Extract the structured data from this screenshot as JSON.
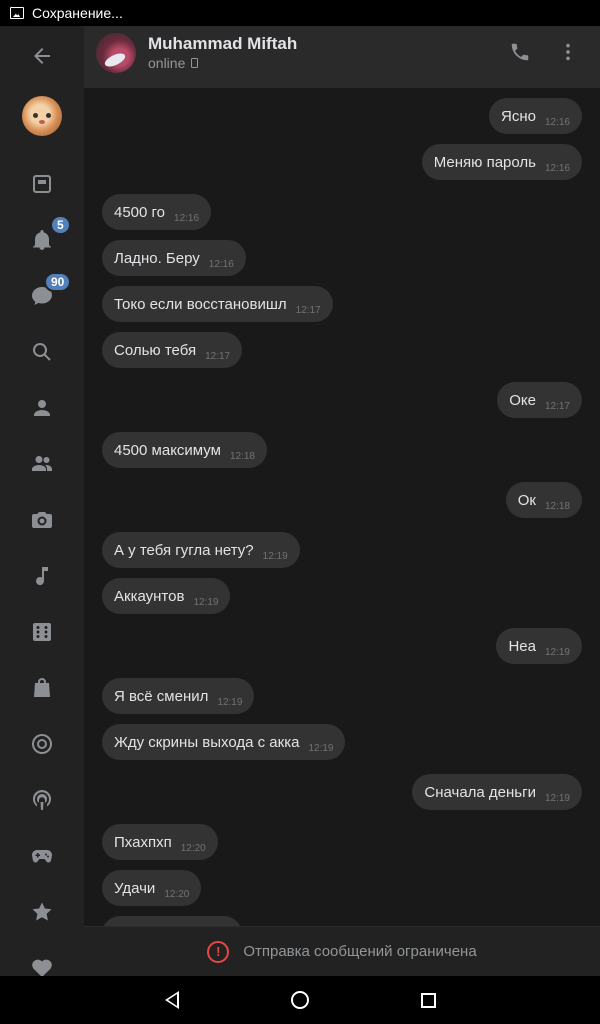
{
  "status_bar": {
    "text": "Сохранение..."
  },
  "sidebar": {
    "notifications_badge": "5",
    "messages_badge": "90",
    "icons": [
      "back-arrow-icon",
      "news-icon",
      "bell-icon",
      "chat-icon",
      "search-icon",
      "person-icon",
      "people-icon",
      "camera-icon",
      "music-icon",
      "apps-icon",
      "shop-icon",
      "target-icon",
      "podcast-icon",
      "gamepad-icon",
      "star-icon",
      "heart-icon"
    ]
  },
  "header": {
    "name": "Muhammad Miftah",
    "status": "online"
  },
  "messages": [
    {
      "dir": "out",
      "text": "Ясно",
      "time": "12:16"
    },
    {
      "dir": "out",
      "text": "Меняю пароль",
      "time": "12:16"
    },
    {
      "dir": "in",
      "text": "4500 го",
      "time": "12:16"
    },
    {
      "dir": "in",
      "text": "Ладно. Беру",
      "time": "12:16"
    },
    {
      "dir": "in",
      "text": "Токо если восстановишл",
      "time": "12:17"
    },
    {
      "dir": "in",
      "text": "Солью тебя",
      "time": "12:17"
    },
    {
      "dir": "out",
      "text": "Оке",
      "time": "12:17"
    },
    {
      "dir": "in",
      "text": "4500 максимум",
      "time": "12:18"
    },
    {
      "dir": "out",
      "text": "Ок",
      "time": "12:18"
    },
    {
      "dir": "in",
      "text": "А у тебя гугла нету?",
      "time": "12:19"
    },
    {
      "dir": "in",
      "text": "Аккаунтов",
      "time": "12:19"
    },
    {
      "dir": "out",
      "text": "Неа",
      "time": "12:19"
    },
    {
      "dir": "in",
      "text": "Я всё сменил",
      "time": "12:19"
    },
    {
      "dir": "in",
      "text": "Жду скрины выхода с акка",
      "time": "12:19"
    },
    {
      "dir": "out",
      "text": "Сначала деньги",
      "time": "12:19"
    },
    {
      "dir": "in",
      "text": "Пхахпхп",
      "time": "12:20"
    },
    {
      "dir": "in",
      "text": "Удачи",
      "time": "12:20"
    }
  ],
  "restriction": {
    "text": "Отправка сообщений ограничена"
  },
  "colors": {
    "accent": "#5181b8",
    "warning": "#e64646",
    "bubble": "#333333",
    "background": "#19191a"
  }
}
